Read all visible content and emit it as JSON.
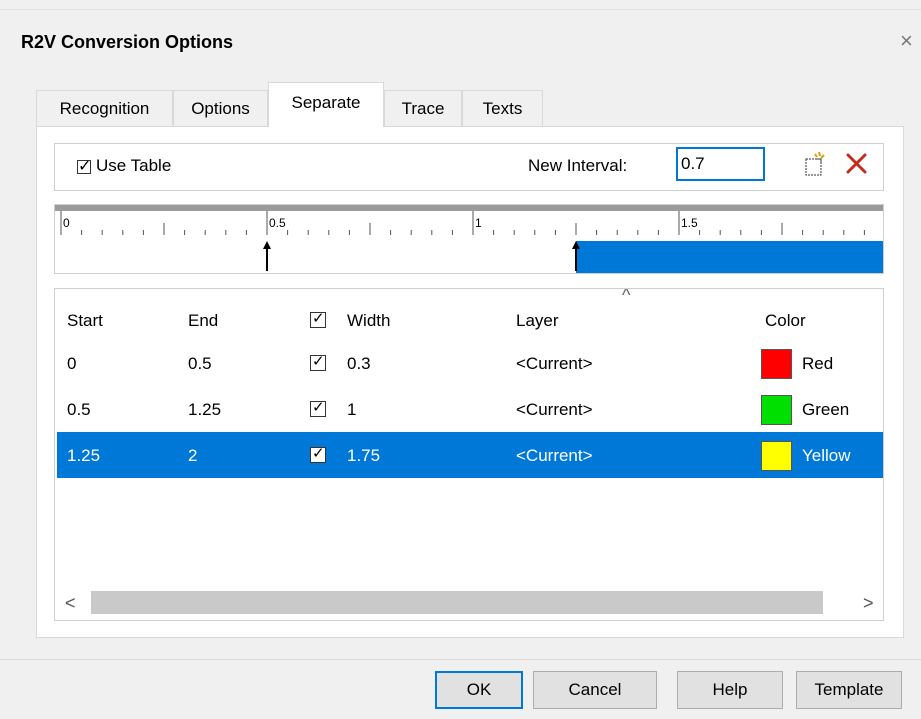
{
  "window": {
    "title": "R2V Conversion Options",
    "close_glyph": "×"
  },
  "tabs": [
    {
      "label": "Recognition"
    },
    {
      "label": "Options"
    },
    {
      "label": "Separate",
      "active": true
    },
    {
      "label": "Trace"
    },
    {
      "label": "Texts"
    }
  ],
  "separate": {
    "use_table_label": "Use Table",
    "use_table_checked": true,
    "new_interval_label": "New Interval:",
    "new_interval_value": "0.7",
    "new_icon": "new-document-icon",
    "delete_icon": "delete-x-icon"
  },
  "ruler": {
    "labels": [
      "0",
      "0.5",
      "1",
      "1.5"
    ],
    "markers": [
      0.5,
      1.25
    ],
    "highlight_from": 1.25,
    "accent": "#0078d7"
  },
  "table": {
    "headers": {
      "start": "Start",
      "end": "End",
      "width": "Width",
      "layer": "Layer",
      "color": "Color"
    },
    "rows": [
      {
        "start": "0",
        "end": "0.5",
        "checked": true,
        "width": "0.3",
        "layer": "<Current>",
        "color_name": "Red",
        "color_hex": "#ff0000"
      },
      {
        "start": "0.5",
        "end": "1.25",
        "checked": true,
        "width": "1",
        "layer": "<Current>",
        "color_name": "Green",
        "color_hex": "#00e000"
      },
      {
        "start": "1.25",
        "end": "2",
        "checked": true,
        "width": "1.75",
        "layer": "<Current>",
        "color_name": "Yellow",
        "color_hex": "#ffff00",
        "selected": true
      }
    ],
    "scroll_left": "<",
    "scroll_right": ">"
  },
  "buttons": {
    "ok": "OK",
    "cancel": "Cancel",
    "help": "Help",
    "template": "Template"
  }
}
